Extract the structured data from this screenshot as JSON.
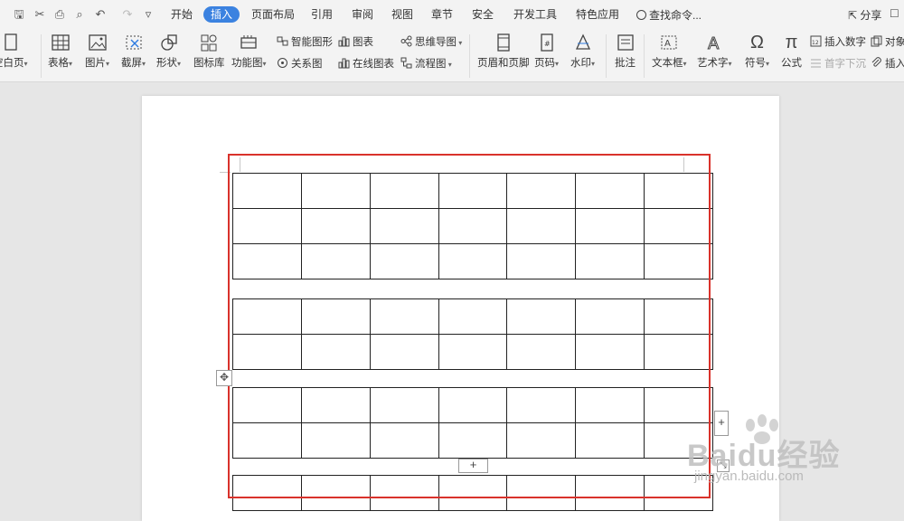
{
  "menu": {
    "tabs": [
      "开始",
      "插入",
      "页面布局",
      "引用",
      "审阅",
      "视图",
      "章节",
      "安全",
      "开发工具",
      "特色应用"
    ],
    "active_tab": "插入",
    "search_label": "查找命令...",
    "share_label": "分享"
  },
  "ribbon": {
    "blank_page": "空白页",
    "table": "表格",
    "picture": "图片",
    "screenshot": "截屏",
    "shape": "形状",
    "icon_lib": "图标库",
    "func_chart": "功能图",
    "smart_shape": "智能图形",
    "chart": "图表",
    "mind_map": "思维导图",
    "relation": "关系图",
    "online_chart": "在线图表",
    "flowchart": "流程图",
    "header_footer": "页眉和页脚",
    "page_number": "页码",
    "watermark": "水印",
    "comment": "批注",
    "textbox": "文本框",
    "wordart": "艺术字",
    "symbol": "符号",
    "formula": "公式",
    "insert_number": "插入数字",
    "drop_cap": "首字下沉",
    "object": "对象",
    "attachment": "插入"
  },
  "document": {
    "table_rows_group1": 3,
    "table_rows_group2": 2,
    "table_rows_group3": 2,
    "table_cols": 7
  },
  "watermark": {
    "brand": "Baidu经验",
    "url": "jingyan.baidu.com"
  },
  "colors": {
    "accent": "#3b82e0",
    "highlight": "#d9322b"
  }
}
